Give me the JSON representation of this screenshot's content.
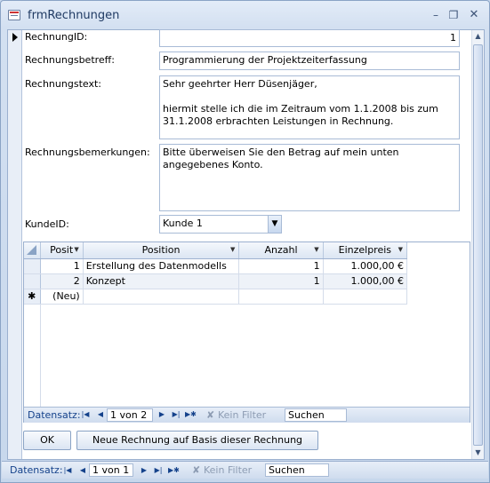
{
  "window": {
    "title": "frmRechnungen"
  },
  "fields": {
    "rechnungid_label": "RechnungID:",
    "rechnungid_value": "1",
    "betreff_label": "Rechnungsbetreff:",
    "betreff_value": "Programmierung der Projektzeiterfassung",
    "text_label": "Rechnungstext:",
    "text_line1": "Sehr geehrter Herr Düsenjäger,",
    "text_line2": "hiermit stelle ich die im Zeitraum vom 1.1.2008 bis zum",
    "text_line3": "31.1.2008 erbrachten Leistungen in Rechnung.",
    "bemerkungen_label": "Rechnungsbemerkungen:",
    "bemerkungen_line1": "Bitte überweisen Sie den Betrag auf mein unten",
    "bemerkungen_line2": "angegebenes Konto.",
    "kunde_label": "KundeID:",
    "kunde_value": "Kunde 1"
  },
  "subform": {
    "columns": [
      "Posit",
      "Position",
      "Anzahl",
      "Einzelpreis"
    ],
    "rows": [
      {
        "posit": "1",
        "position": "Erstellung des Datenmodells",
        "anzahl": "1",
        "einzelpreis": "1.000,00 €"
      },
      {
        "posit": "2",
        "position": "Konzept",
        "anzahl": "1",
        "einzelpreis": "1.000,00 €"
      }
    ],
    "new_row_marker": "✱",
    "new_row_label": "(Neu)",
    "nav": {
      "label": "Datensatz:",
      "position": "1 von 2",
      "filter": "Kein Filter",
      "search": "Suchen"
    }
  },
  "buttons": {
    "ok": "OK",
    "new_invoice": "Neue Rechnung auf Basis dieser Rechnung"
  },
  "main_nav": {
    "label": "Datensatz:",
    "position": "1 von 1",
    "filter": "Kein Filter",
    "search": "Suchen"
  }
}
